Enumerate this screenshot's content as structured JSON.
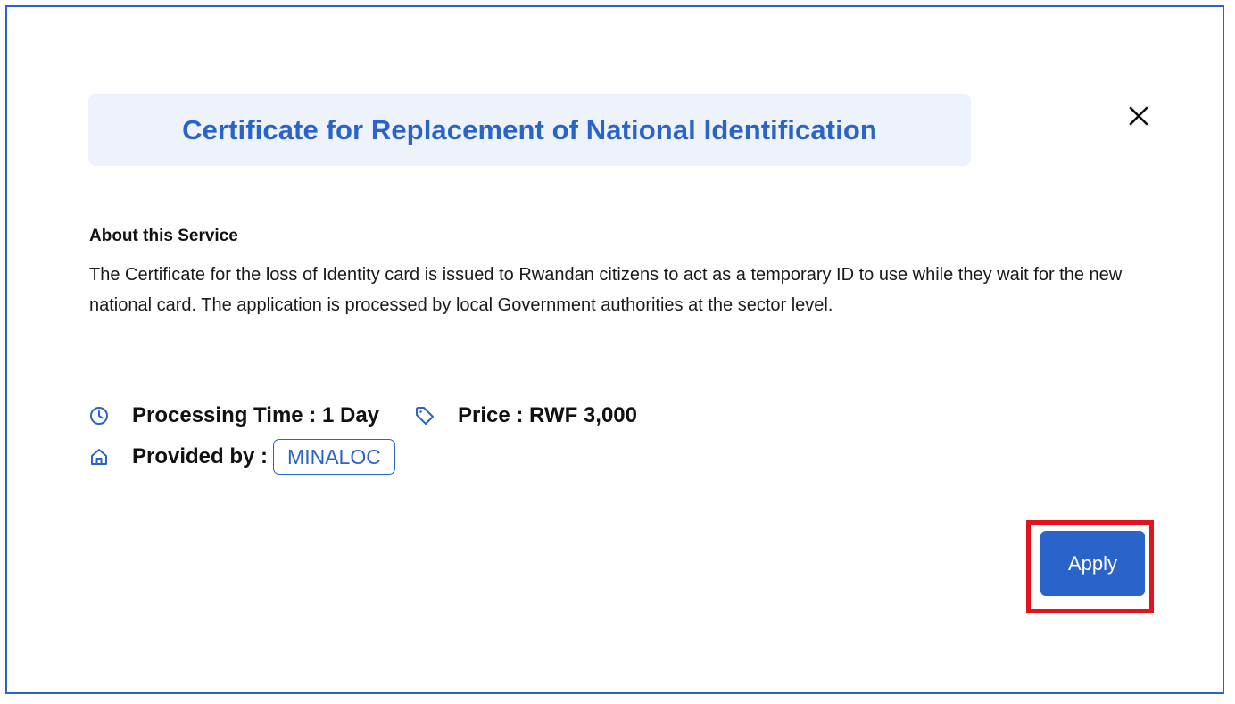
{
  "service": {
    "title": "Certificate for Replacement of National Identification",
    "about_heading": "About this Service",
    "about_text": "The Certificate for the loss of Identity card is issued to Rwandan citizens to act as a temporary ID to use while they wait for the new national card. The application is processed by local Government authorities at the sector level.",
    "processing_time": "Processing Time : 1 Day",
    "price": "Price : RWF 3,000",
    "provided_by_label": "Provided by :",
    "provider": "MINALOC"
  },
  "actions": {
    "apply_label": "Apply"
  },
  "icons": {
    "close": "close-icon",
    "processing": "clock-icon",
    "price": "tag-icon",
    "provider": "building-icon"
  },
  "colors": {
    "accent": "#2a64c8",
    "title_background": "#eef3fb",
    "highlight": "#e0141e"
  }
}
